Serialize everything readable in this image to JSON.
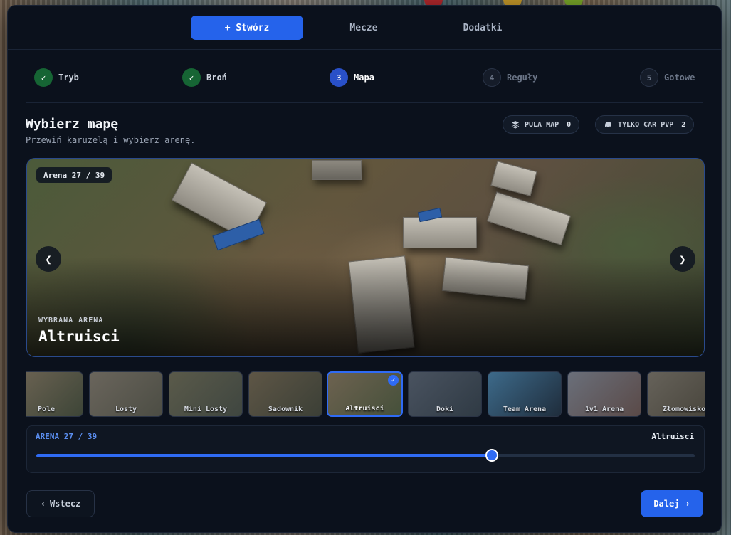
{
  "nav": {
    "tabs": [
      {
        "label": "+ Stwórz",
        "active": true
      },
      {
        "label": "Mecze",
        "active": false
      },
      {
        "label": "Dodatki",
        "active": false
      }
    ]
  },
  "stepper": {
    "steps": [
      {
        "label": "Tryb",
        "state": "done",
        "marker": "✓"
      },
      {
        "label": "Broń",
        "state": "done",
        "marker": "✓"
      },
      {
        "label": "Mapa",
        "state": "current",
        "marker": "3"
      },
      {
        "label": "Reguły",
        "state": "todo",
        "marker": "4"
      },
      {
        "label": "Gotowe",
        "state": "todo",
        "marker": "5"
      }
    ]
  },
  "section": {
    "title": "Wybierz mapę",
    "subtitle": "Przewiń karuzelą i wybierz arenę."
  },
  "pills": {
    "map_pool": {
      "label": "PULA MAP",
      "count": "0",
      "icon": "layers-icon"
    },
    "car_pvp": {
      "label": "TYLKO CAR PVP",
      "count": "2",
      "icon": "car-icon"
    }
  },
  "hero": {
    "badge": "Arena 27 / 39",
    "selected_label": "WYBRANA ARENA",
    "selected_name": "Altruisci"
  },
  "thumbnails": [
    {
      "label": "Pole",
      "selected": false
    },
    {
      "label": "Losty",
      "selected": false
    },
    {
      "label": "Mini Losty",
      "selected": false
    },
    {
      "label": "Sadownik",
      "selected": false
    },
    {
      "label": "Altruisci",
      "selected": true
    },
    {
      "label": "Doki",
      "selected": false
    },
    {
      "label": "Team Arena",
      "selected": false
    },
    {
      "label": "1v1 Arena",
      "selected": false
    },
    {
      "label": "Złomowisko",
      "selected": false
    }
  ],
  "slider": {
    "left_label": "ARENA 27 / 39",
    "right_label": "Altruisci",
    "value": 27,
    "max": 39
  },
  "footer": {
    "back_label": "Wstecz",
    "next_label": "Dalej"
  },
  "colors": {
    "accent": "#2563eb",
    "done": "#166534",
    "panel": "#0b111c"
  }
}
